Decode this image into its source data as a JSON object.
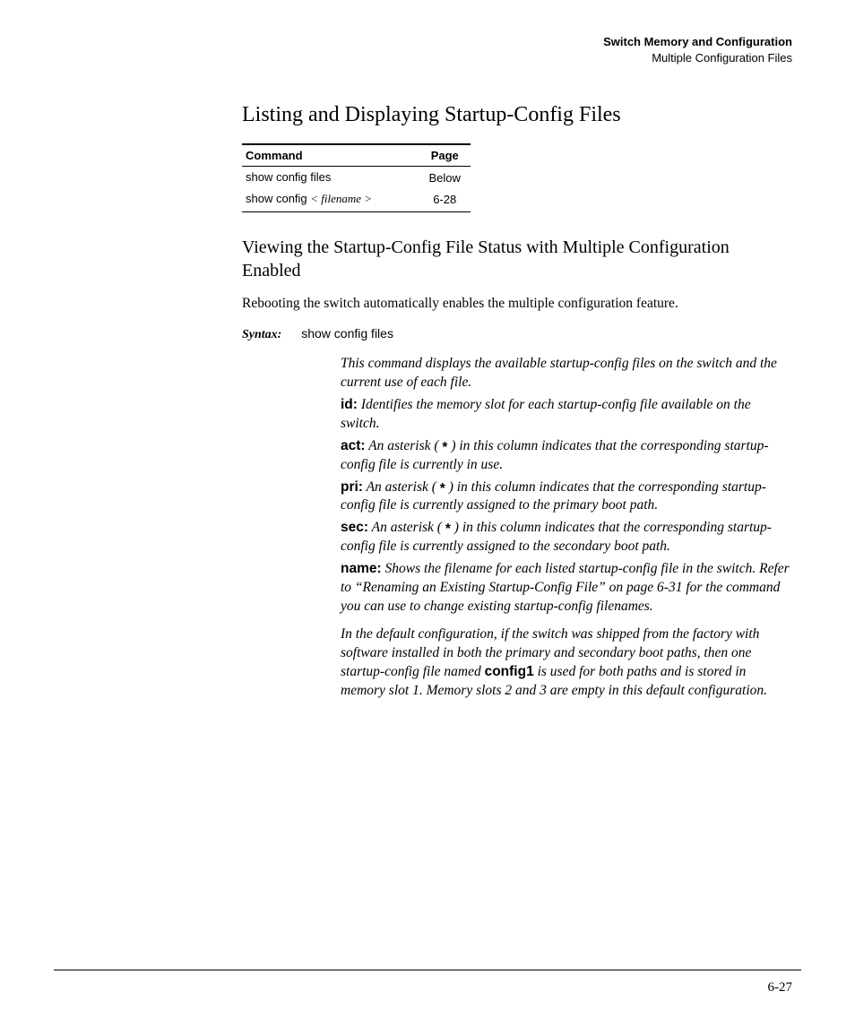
{
  "header": {
    "chapter": "Switch Memory and Configuration",
    "section": "Multiple Configuration Files"
  },
  "title": "Listing and Displaying Startup-Config Files",
  "table": {
    "head_cmd": "Command",
    "head_page": "Page",
    "rows": [
      {
        "cmd_plain": "show config files",
        "cmd_ital": "",
        "page": "Below"
      },
      {
        "cmd_plain": "show config ",
        "cmd_ital": "< filename >",
        "page": "6-28"
      }
    ]
  },
  "subsection": "Viewing the Startup-Config File Status with Multiple Configuration Enabled",
  "intro": "Rebooting the switch automatically enables the multiple configuration feature.",
  "syntax": {
    "label": "Syntax:",
    "cmd": "show config files"
  },
  "desc": {
    "lead": "This command displays the available startup-config files on the switch and the current use of each file.",
    "id_lbl": "id:",
    "id_txt": " Identifies the memory slot for each startup-config file available on the switch.",
    "act_lbl": "act:",
    "act_pre": " An asterisk ( ",
    "star": "*",
    "act_post": " ) in this column indicates that the corresponding startup-config file is currently in use.",
    "pri_lbl": "pri:",
    "pri_pre": " An asterisk ( ",
    "pri_post": " ) in this column indicates that the corresponding startup-config file is currently assigned to the primary boot path.",
    "sec_lbl": "sec:",
    "sec_pre": " An asterisk ( ",
    "sec_post": " ) in this column indicates that the corresponding startup-config file is currently assigned to the secondary boot path.",
    "name_lbl": "name:",
    "name_txt": " Shows the filename for each listed startup-config file in the switch. Refer to “Renaming an Existing Startup-Config File” on page 6-31 for the command you can use to change existing startup-config filenames.",
    "tail_pre": "In the default configuration, if the switch was shipped from the factory with software installed in both the primary and secondary boot paths, then one startup-config file named ",
    "tail_bold": "config1",
    "tail_post": " is used for both paths and is stored in memory slot 1. Memory slots 2 and 3 are empty in this default configuration."
  },
  "page_number": "6-27"
}
